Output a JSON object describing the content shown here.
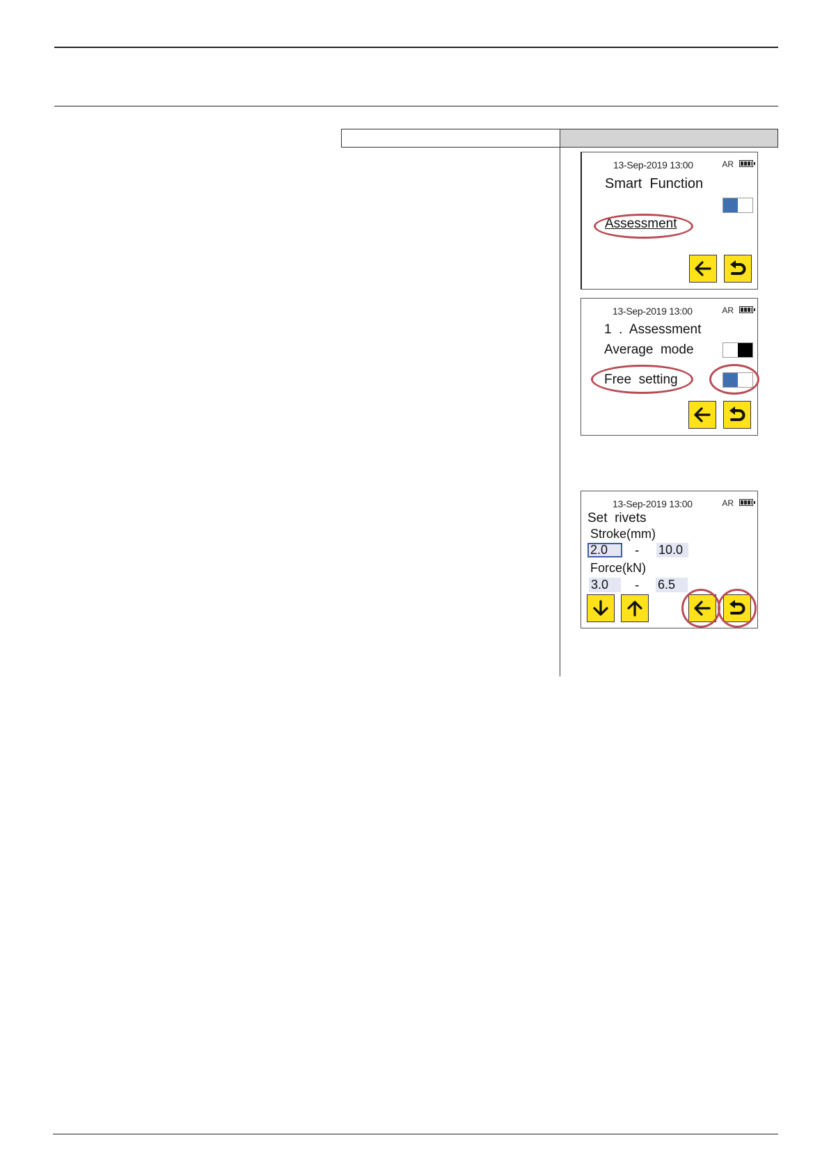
{
  "screens": [
    {
      "status": "13-Sep-2019   13:00",
      "indicator": "AR",
      "title": "Smart  Function",
      "menu_item": "Assessment",
      "toggle_state": "on"
    },
    {
      "status": "13-Sep-2019   13:00",
      "indicator": "AR",
      "title": "1  .  Assessment",
      "row1_label": "Average  mode",
      "row1_toggle": "off",
      "row2_label": "Free  setting",
      "row2_toggle": "on"
    },
    {
      "status": "13-Sep-2019   13:00",
      "indicator": "AR",
      "title": "Set  rivets",
      "stroke_label": "Stroke(mm)",
      "stroke_min": "2.0",
      "stroke_max": "10.0",
      "force_label": "Force(kN)",
      "force_min": "3.0",
      "force_max": "6.5",
      "dash": "-"
    }
  ],
  "icons": {
    "back": "arrow-left-icon",
    "return": "undo-return-icon",
    "down": "arrow-down-icon",
    "up": "arrow-up-icon"
  },
  "colors": {
    "button_yellow": "#ffe21a",
    "toggle_blue": "#3e6fb1",
    "highlight_red": "#b84d55",
    "field_bg": "#e4e6f4"
  }
}
